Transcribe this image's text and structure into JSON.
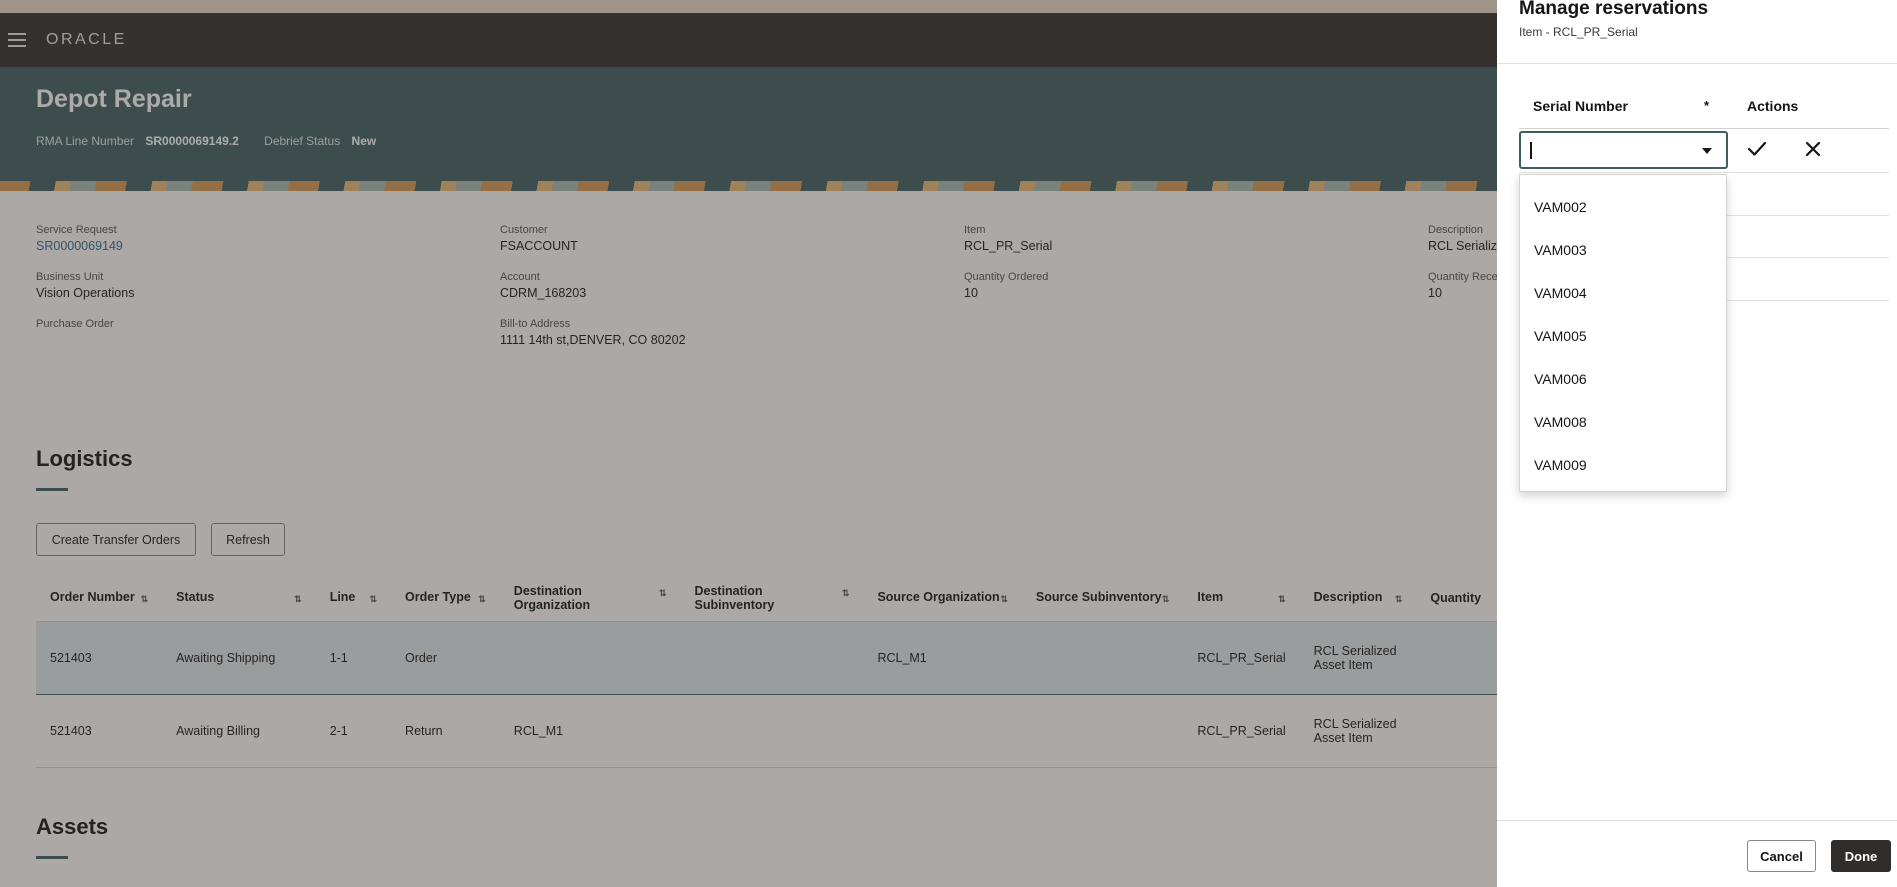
{
  "app": {
    "logo": "ORACLE"
  },
  "header": {
    "title": "Depot Repair",
    "rma_label": "RMA Line Number",
    "rma_value": "SR0000069149.2",
    "debrief_label": "Debrief Status",
    "debrief_value": "New"
  },
  "summary": {
    "service_request": {
      "label": "Service Request",
      "value": "SR0000069149"
    },
    "business_unit": {
      "label": "Business Unit",
      "value": "Vision Operations"
    },
    "purchase_order": {
      "label": "Purchase Order"
    },
    "customer": {
      "label": "Customer",
      "value": "FSACCOUNT"
    },
    "account": {
      "label": "Account",
      "value": "CDRM_168203"
    },
    "bill_to": {
      "label": "Bill-to Address",
      "value": "1111 14th st,DENVER, CO 80202"
    },
    "item": {
      "label": "Item",
      "value": "RCL_PR_Serial"
    },
    "quantity_ordered": {
      "label": "Quantity Ordered",
      "value": "10"
    },
    "description": {
      "label": "Description",
      "value": "RCL Serialize"
    },
    "quantity_received": {
      "label": "Quantity Rece",
      "value": "10"
    }
  },
  "logistics": {
    "title": "Logistics",
    "create_transfer_orders": "Create Transfer Orders",
    "refresh": "Refresh",
    "columns": [
      "Order Number",
      "Status",
      "Line",
      "Order Type",
      "Destination Organization",
      "Destination Subinventory",
      "Source Organization",
      "Source Subinventory",
      "Item",
      "Description",
      "Quantity"
    ],
    "rows": [
      [
        "521403",
        "Awaiting Shipping",
        "1-1",
        "Order",
        "",
        "",
        "RCL_M1",
        "",
        "RCL_PR_Serial",
        "RCL Serialized Asset Item",
        ""
      ],
      [
        "521403",
        "Awaiting Billing",
        "2-1",
        "Return",
        "RCL_M1",
        "",
        "",
        "",
        "RCL_PR_Serial",
        "RCL Serialized Asset Item",
        ""
      ]
    ]
  },
  "assets": {
    "title": "Assets"
  },
  "drawer": {
    "title": "Manage reservations",
    "subtitle": "Item - RCL_PR_Serial",
    "col_serial": "Serial Number",
    "required_mark": "*",
    "col_actions": "Actions",
    "serial_input_value": "",
    "options": [
      "VAM002",
      "VAM003",
      "VAM004",
      "VAM005",
      "VAM006",
      "VAM008",
      "VAM009"
    ],
    "cancel": "Cancel",
    "done": "Done"
  }
}
